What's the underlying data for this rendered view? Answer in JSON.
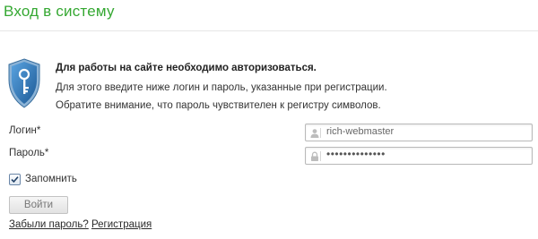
{
  "page": {
    "title": "Вход в систему"
  },
  "notice": {
    "icon": "shield-key-icon",
    "heading": "Для работы на сайте необходимо авторизоваться.",
    "line1": "Для этого введите ниже логин и пароль, указанные при регистрации.",
    "line2": "Обратите внимание, что пароль чувствителен к регистру символов."
  },
  "form": {
    "login_label": "Логин*",
    "login_value": "rich-webmaster",
    "login_icon": "user-icon",
    "password_label": "Пароль*",
    "password_value": "••••••••••••••",
    "password_icon": "lock-icon",
    "remember_label": "Запомнить",
    "remember_checked": true,
    "submit_label": "Войти"
  },
  "links": {
    "forgot": "Забыли пароль?",
    "register": "Регистрация"
  },
  "colors": {
    "title": "#35a832",
    "shield": "#2a6fb0"
  }
}
